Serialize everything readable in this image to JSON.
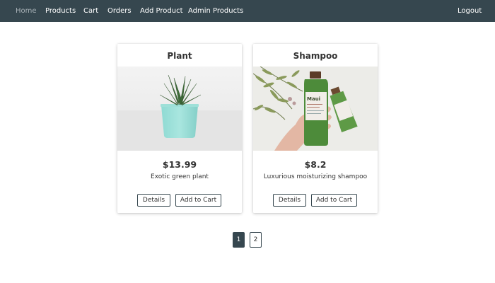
{
  "nav": {
    "home": "Home",
    "products": "Products",
    "cart": "Cart",
    "orders": "Orders",
    "add_product": "Add Product",
    "admin_products": "Admin Products",
    "logout": "Logout"
  },
  "products": [
    {
      "title": "Plant",
      "price": "$13.99",
      "description": "Exotic green plant",
      "details_label": "Details",
      "add_to_cart_label": "Add to Cart"
    },
    {
      "title": "Shampoo",
      "price": "$8.2",
      "description": "Luxurious moisturizing shampoo",
      "details_label": "Details",
      "add_to_cart_label": "Add to Cart"
    }
  ],
  "pagination": {
    "pages": [
      "1",
      "2"
    ],
    "current": "1"
  },
  "colors": {
    "navbar": "#36474f",
    "nav_active": "#a8b2b7",
    "accent": "#36474f"
  }
}
